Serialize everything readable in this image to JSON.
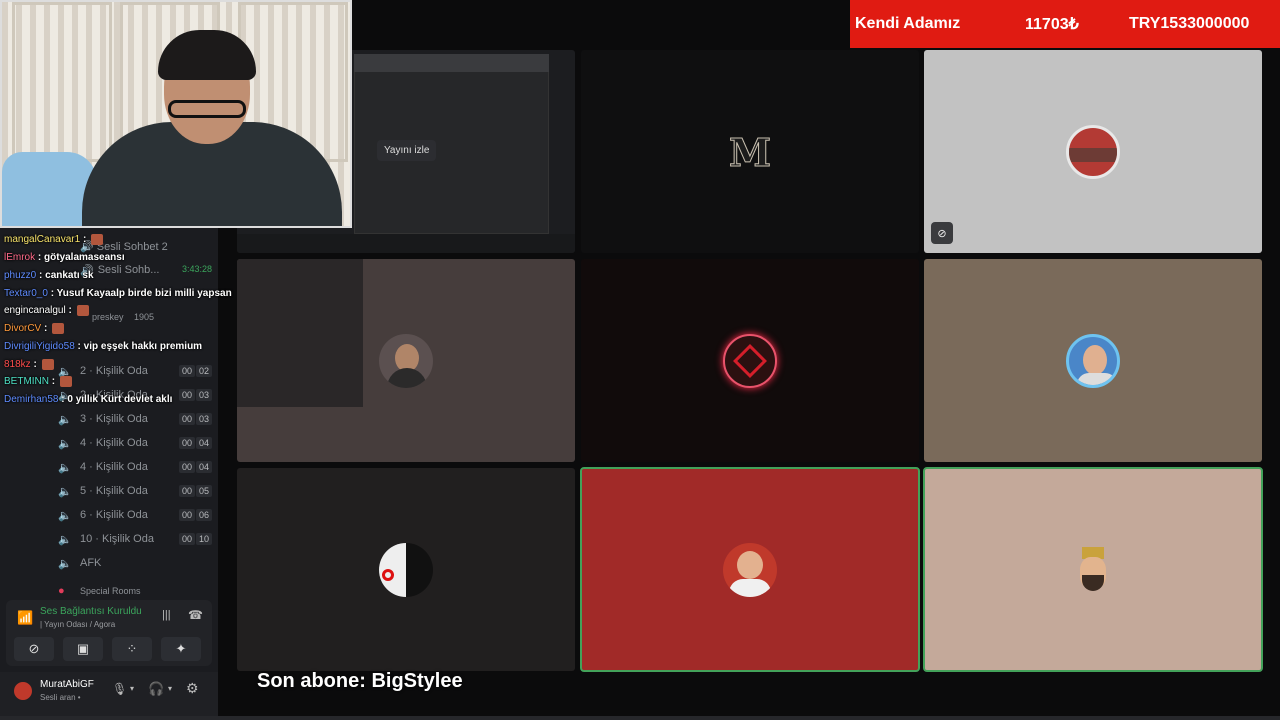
{
  "banner": {
    "label": "Kendi Adamız",
    "amount": "11703₺",
    "goal": "TRY1533000000"
  },
  "webcam": {
    "alt": "streamer webcam"
  },
  "voice_header": {
    "channel_1": "Sesli Sohbet 2",
    "channel_2": "Sesli Sohb...",
    "timer": "3:43:28",
    "member_1": "preskey",
    "member_1_badge": "1905"
  },
  "channels": [
    {
      "name": "2 · Kişilik Oda",
      "cnt": [
        "00",
        "02"
      ]
    },
    {
      "name": "2 · Kişilik Oda",
      "cnt": [
        "00",
        "03"
      ]
    },
    {
      "name": "3 · Kişilik Oda",
      "cnt": [
        "00",
        "03"
      ]
    },
    {
      "name": "4 · Kişilik Oda",
      "cnt": [
        "00",
        "04"
      ]
    },
    {
      "name": "4 · Kişilik Oda",
      "cnt": [
        "00",
        "04"
      ]
    },
    {
      "name": "5 · Kişilik Oda",
      "cnt": [
        "00",
        "05"
      ]
    },
    {
      "name": "6 · Kişilik Oda",
      "cnt": [
        "00",
        "06"
      ]
    },
    {
      "name": "10 · Kişilik Oda",
      "cnt": [
        "00",
        "10"
      ]
    },
    {
      "name": "AFK",
      "cnt": []
    },
    {
      "name": "Special Rooms",
      "cnt": []
    }
  ],
  "chat": [
    {
      "user": "mangalCanavar1",
      "color": "#f7e36b",
      "msg": ""
    },
    {
      "user": "lEmrok",
      "color": "#ff6b8a",
      "msg": "götyalamaseansı"
    },
    {
      "user": "phuzz0",
      "color": "#5f8cff",
      "msg": "cankatı sk"
    },
    {
      "user": "Textar0_0",
      "color": "#5f8cff",
      "msg": "Yusuf Kayaalp birde bizi milli yapsan"
    },
    {
      "user": "engincanalgul",
      "color": "#ffffff",
      "msg": ""
    },
    {
      "user": "DivorCV",
      "color": "#ff9a3c",
      "msg": ""
    },
    {
      "user": "DivrigiliYigido58",
      "color": "#5f8cff",
      "msg": "vip eşşek hakkı premium"
    },
    {
      "user": "818kz",
      "color": "#ff4d4d",
      "msg": ""
    },
    {
      "user": "BETMINN",
      "color": "#4ee0c5",
      "msg": ""
    },
    {
      "user": "Demirhan58",
      "color": "#5f8cff",
      "msg": "0 yıllık Kürt devlet aklı"
    }
  ],
  "voice_panel": {
    "status": "Ses Bağlantısı Kuruldu",
    "location": "| Yayın Odası / Agora"
  },
  "user_panel": {
    "name": "MuratAbiGF",
    "status": "Sesli aran •"
  },
  "stream_tile": {
    "watch_label": "Yayını izle"
  },
  "m_logo": "M",
  "subscriber": "Son abone: BigStylee",
  "colors": {
    "banner_red": "#e01b12",
    "speaking_green": "#43a25a",
    "voice_green": "#3ba55c"
  }
}
